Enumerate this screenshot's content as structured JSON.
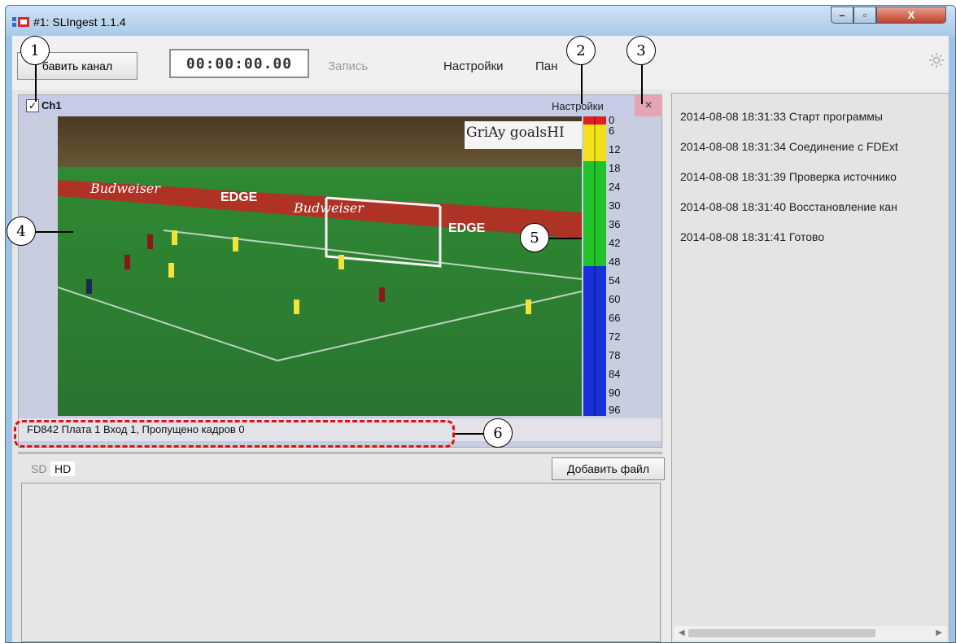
{
  "window": {
    "title": "#1: SLIngest 1.1.4",
    "controls": {
      "minimize": "–",
      "maximize": "▫",
      "close": "X"
    }
  },
  "toolbar": {
    "add_channel_label": "бавить канал",
    "timecode": "00:00:00.00",
    "record_label": "Запись",
    "settings_label": "Настройки",
    "panel_label": "Пан"
  },
  "channel": {
    "checked": true,
    "check_mark": "✓",
    "name": "Ch1",
    "settings_label": "Настройки",
    "close_label": "×",
    "video_overlay_text": "GriAy goalsHI",
    "ad_boards": [
      "Budweiser",
      "EDGE",
      "Budweiser",
      "EDGE"
    ],
    "status_text": "FD842 Плата 1 Вход 1,  Пропущено кадров 0",
    "vu_scale": [
      "0",
      "6",
      "12",
      "18",
      "24",
      "30",
      "36",
      "42",
      "48",
      "54",
      "60",
      "66",
      "72",
      "78",
      "84",
      "90",
      "96"
    ],
    "vu_colors": {
      "red": "#e02020",
      "yellow": "#f2e01a",
      "green": "#22c22a",
      "blue": "#1830d8"
    }
  },
  "files": {
    "tabs": [
      {
        "label": "SD",
        "active": false
      },
      {
        "label": "HD",
        "active": true
      }
    ],
    "add_file_label": "Добавить файл"
  },
  "log": {
    "lines": [
      "2014-08-08 18:31:33  Старт программы",
      "2014-08-08 18:31:34  Соединение с FDExt",
      "2014-08-08 18:31:39  Проверка источнико",
      "2014-08-08 18:31:40  Восстановление кан",
      "2014-08-08 18:31:41  Готово"
    ]
  },
  "callouts": [
    "1",
    "2",
    "3",
    "4",
    "5",
    "6"
  ]
}
